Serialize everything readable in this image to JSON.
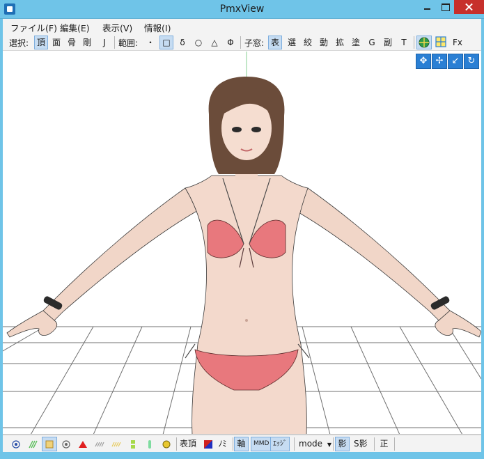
{
  "window": {
    "title": "PmxView",
    "app_icon": "pmx-app-icon",
    "controls": [
      "minimize-icon",
      "maximize-icon",
      "close-icon"
    ]
  },
  "menu": {
    "items": [
      "ファイル(F)",
      "編集(E)",
      "表示(V)",
      "情報(I)"
    ]
  },
  "toolbar": {
    "select_label": "選択:",
    "select_items": [
      "頂",
      "面",
      "骨",
      "剛",
      "J"
    ],
    "range_label": "範囲:",
    "range_items": [
      "・",
      "□",
      "δ",
      "○",
      "△",
      "Φ"
    ],
    "child_label": "子窓:",
    "child_items": [
      "表",
      "選",
      "絞",
      "動",
      "拡",
      "塗",
      "G",
      "副",
      "T"
    ],
    "extra_items": [
      "Fx"
    ]
  },
  "view_tools": {
    "buttons": [
      "move-icon",
      "pan-icon",
      "axis-icon",
      "rotate-icon"
    ]
  },
  "viewport": {
    "content": "3d-model-render",
    "accent_colors": {
      "bikini": "#e8787d",
      "skin": "#f2d9ce",
      "hair": "#6b4c3a",
      "grid": "#6a6a6a",
      "axis": "#7fd08a"
    }
  },
  "statusbar": {
    "icon_buttons": [
      "vertex-icon",
      "edge-icon",
      "face-icon",
      "center-icon",
      "triangle-icon",
      "wire-icon",
      "wire2-icon",
      "bone-icon",
      "bone2-icon",
      "morph-icon"
    ],
    "vertex_label": "表頂",
    "morph_label": "ﾉﾐ",
    "axis_label": "軸",
    "mmd_label": "MMD",
    "edge_label": "ｴｯｼﾞ",
    "mode_label": "mode",
    "shadow_label": "影",
    "sshadow_label": "S影",
    "ortho_label": "正"
  }
}
